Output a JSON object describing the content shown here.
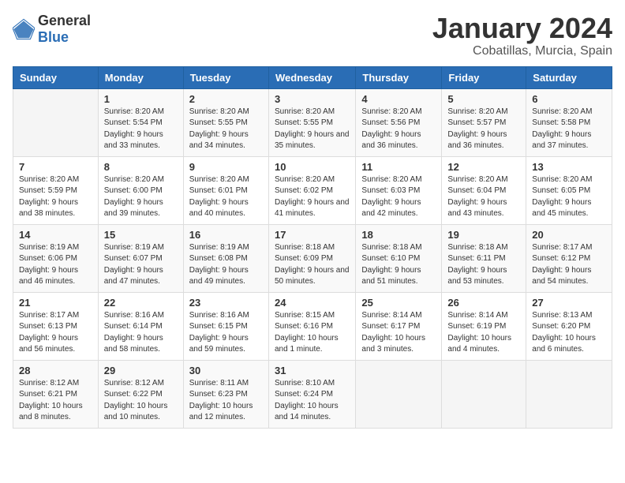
{
  "header": {
    "logo": {
      "general": "General",
      "blue": "Blue"
    },
    "title": "January 2024",
    "location": "Cobatillas, Murcia, Spain"
  },
  "weekdays": [
    "Sunday",
    "Monday",
    "Tuesday",
    "Wednesday",
    "Thursday",
    "Friday",
    "Saturday"
  ],
  "weeks": [
    [
      {
        "day": "",
        "sunrise": "",
        "sunset": "",
        "daylight": ""
      },
      {
        "day": "1",
        "sunrise": "Sunrise: 8:20 AM",
        "sunset": "Sunset: 5:54 PM",
        "daylight": "Daylight: 9 hours and 33 minutes."
      },
      {
        "day": "2",
        "sunrise": "Sunrise: 8:20 AM",
        "sunset": "Sunset: 5:55 PM",
        "daylight": "Daylight: 9 hours and 34 minutes."
      },
      {
        "day": "3",
        "sunrise": "Sunrise: 8:20 AM",
        "sunset": "Sunset: 5:55 PM",
        "daylight": "Daylight: 9 hours and 35 minutes."
      },
      {
        "day": "4",
        "sunrise": "Sunrise: 8:20 AM",
        "sunset": "Sunset: 5:56 PM",
        "daylight": "Daylight: 9 hours and 36 minutes."
      },
      {
        "day": "5",
        "sunrise": "Sunrise: 8:20 AM",
        "sunset": "Sunset: 5:57 PM",
        "daylight": "Daylight: 9 hours and 36 minutes."
      },
      {
        "day": "6",
        "sunrise": "Sunrise: 8:20 AM",
        "sunset": "Sunset: 5:58 PM",
        "daylight": "Daylight: 9 hours and 37 minutes."
      }
    ],
    [
      {
        "day": "7",
        "sunrise": "Sunrise: 8:20 AM",
        "sunset": "Sunset: 5:59 PM",
        "daylight": "Daylight: 9 hours and 38 minutes."
      },
      {
        "day": "8",
        "sunrise": "Sunrise: 8:20 AM",
        "sunset": "Sunset: 6:00 PM",
        "daylight": "Daylight: 9 hours and 39 minutes."
      },
      {
        "day": "9",
        "sunrise": "Sunrise: 8:20 AM",
        "sunset": "Sunset: 6:01 PM",
        "daylight": "Daylight: 9 hours and 40 minutes."
      },
      {
        "day": "10",
        "sunrise": "Sunrise: 8:20 AM",
        "sunset": "Sunset: 6:02 PM",
        "daylight": "Daylight: 9 hours and 41 minutes."
      },
      {
        "day": "11",
        "sunrise": "Sunrise: 8:20 AM",
        "sunset": "Sunset: 6:03 PM",
        "daylight": "Daylight: 9 hours and 42 minutes."
      },
      {
        "day": "12",
        "sunrise": "Sunrise: 8:20 AM",
        "sunset": "Sunset: 6:04 PM",
        "daylight": "Daylight: 9 hours and 43 minutes."
      },
      {
        "day": "13",
        "sunrise": "Sunrise: 8:20 AM",
        "sunset": "Sunset: 6:05 PM",
        "daylight": "Daylight: 9 hours and 45 minutes."
      }
    ],
    [
      {
        "day": "14",
        "sunrise": "Sunrise: 8:19 AM",
        "sunset": "Sunset: 6:06 PM",
        "daylight": "Daylight: 9 hours and 46 minutes."
      },
      {
        "day": "15",
        "sunrise": "Sunrise: 8:19 AM",
        "sunset": "Sunset: 6:07 PM",
        "daylight": "Daylight: 9 hours and 47 minutes."
      },
      {
        "day": "16",
        "sunrise": "Sunrise: 8:19 AM",
        "sunset": "Sunset: 6:08 PM",
        "daylight": "Daylight: 9 hours and 49 minutes."
      },
      {
        "day": "17",
        "sunrise": "Sunrise: 8:18 AM",
        "sunset": "Sunset: 6:09 PM",
        "daylight": "Daylight: 9 hours and 50 minutes."
      },
      {
        "day": "18",
        "sunrise": "Sunrise: 8:18 AM",
        "sunset": "Sunset: 6:10 PM",
        "daylight": "Daylight: 9 hours and 51 minutes."
      },
      {
        "day": "19",
        "sunrise": "Sunrise: 8:18 AM",
        "sunset": "Sunset: 6:11 PM",
        "daylight": "Daylight: 9 hours and 53 minutes."
      },
      {
        "day": "20",
        "sunrise": "Sunrise: 8:17 AM",
        "sunset": "Sunset: 6:12 PM",
        "daylight": "Daylight: 9 hours and 54 minutes."
      }
    ],
    [
      {
        "day": "21",
        "sunrise": "Sunrise: 8:17 AM",
        "sunset": "Sunset: 6:13 PM",
        "daylight": "Daylight: 9 hours and 56 minutes."
      },
      {
        "day": "22",
        "sunrise": "Sunrise: 8:16 AM",
        "sunset": "Sunset: 6:14 PM",
        "daylight": "Daylight: 9 hours and 58 minutes."
      },
      {
        "day": "23",
        "sunrise": "Sunrise: 8:16 AM",
        "sunset": "Sunset: 6:15 PM",
        "daylight": "Daylight: 9 hours and 59 minutes."
      },
      {
        "day": "24",
        "sunrise": "Sunrise: 8:15 AM",
        "sunset": "Sunset: 6:16 PM",
        "daylight": "Daylight: 10 hours and 1 minute."
      },
      {
        "day": "25",
        "sunrise": "Sunrise: 8:14 AM",
        "sunset": "Sunset: 6:17 PM",
        "daylight": "Daylight: 10 hours and 3 minutes."
      },
      {
        "day": "26",
        "sunrise": "Sunrise: 8:14 AM",
        "sunset": "Sunset: 6:19 PM",
        "daylight": "Daylight: 10 hours and 4 minutes."
      },
      {
        "day": "27",
        "sunrise": "Sunrise: 8:13 AM",
        "sunset": "Sunset: 6:20 PM",
        "daylight": "Daylight: 10 hours and 6 minutes."
      }
    ],
    [
      {
        "day": "28",
        "sunrise": "Sunrise: 8:12 AM",
        "sunset": "Sunset: 6:21 PM",
        "daylight": "Daylight: 10 hours and 8 minutes."
      },
      {
        "day": "29",
        "sunrise": "Sunrise: 8:12 AM",
        "sunset": "Sunset: 6:22 PM",
        "daylight": "Daylight: 10 hours and 10 minutes."
      },
      {
        "day": "30",
        "sunrise": "Sunrise: 8:11 AM",
        "sunset": "Sunset: 6:23 PM",
        "daylight": "Daylight: 10 hours and 12 minutes."
      },
      {
        "day": "31",
        "sunrise": "Sunrise: 8:10 AM",
        "sunset": "Sunset: 6:24 PM",
        "daylight": "Daylight: 10 hours and 14 minutes."
      },
      {
        "day": "",
        "sunrise": "",
        "sunset": "",
        "daylight": ""
      },
      {
        "day": "",
        "sunrise": "",
        "sunset": "",
        "daylight": ""
      },
      {
        "day": "",
        "sunrise": "",
        "sunset": "",
        "daylight": ""
      }
    ]
  ]
}
